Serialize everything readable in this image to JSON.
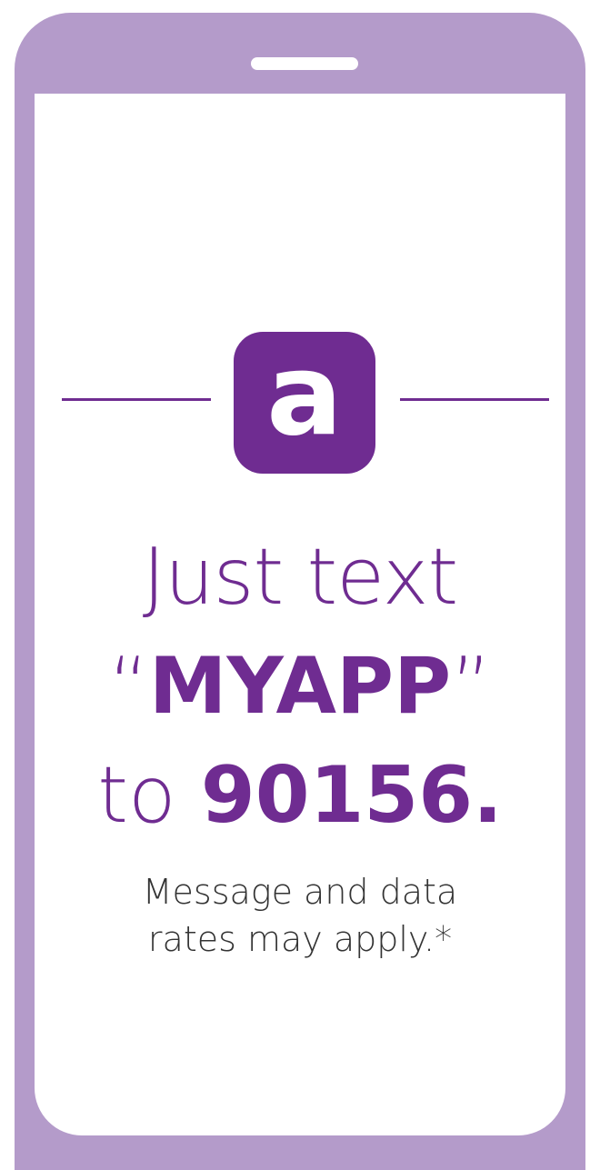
{
  "colors": {
    "phone_frame": "#b49bca",
    "brand_purple": "#6f2c91",
    "screen_bg": "#ffffff",
    "body_text": "#333333"
  },
  "logo": {
    "icon": "app-a-logo-icon",
    "letter": "a"
  },
  "headline": {
    "line1": "Just text",
    "line2_open_quote": "“",
    "line2_keyword": "MYAPP",
    "line2_close_quote": "”",
    "line3_prefix": "to ",
    "line3_number": "90156",
    "line3_period": "."
  },
  "disclaimer": {
    "line1": "Message and data",
    "line2": "rates may apply.*"
  }
}
